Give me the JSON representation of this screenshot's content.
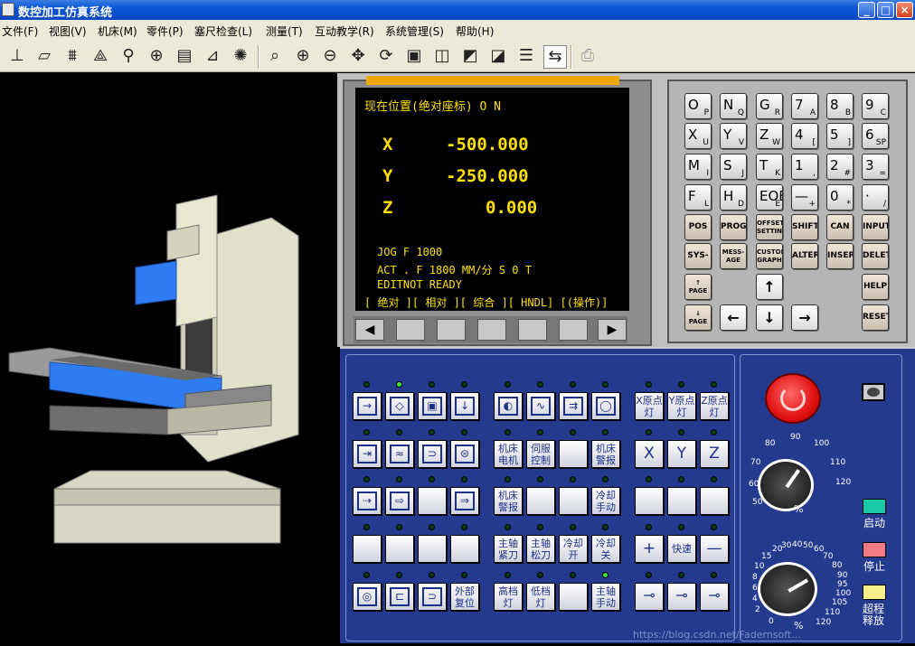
{
  "window": {
    "title": "数控加工仿真系统",
    "min": "_",
    "max": "□",
    "close": "×"
  },
  "menu": [
    "文件(F)",
    "视图(V)",
    "机床(M)",
    "零件(P)",
    "塞尺检查(L)",
    "测量(T)",
    "互动教学(R)",
    "系统管理(S)",
    "帮助(H)"
  ],
  "toolbar": {
    "icons": [
      "spindle-view-icon",
      "workpiece-icon",
      "clamp-icon",
      "tool-icon",
      "tool-change-icon",
      "origin-icon",
      "machine-icon",
      "measure-icon",
      "light-icon",
      "zoom-icon",
      "zoom-in-icon",
      "zoom-out-icon",
      "pan-icon",
      "rotate-icon",
      "front-view-icon",
      "iso-view-icon",
      "side-view-icon",
      "top-view-icon",
      "list-icon",
      "switch-icon",
      "print-icon"
    ]
  },
  "crt": {
    "header": "现在位置(绝对座标)  O     N",
    "x_label": "X",
    "x_value": "-500.000",
    "y_label": "Y",
    "y_value": "-250.000",
    "z_label": "Z",
    "z_value": "0.000",
    "line1": "JOG  F  1000",
    "line2": "ACT . F 1800  MM/分    S  0   T",
    "line3": "EDITNOT READY",
    "softkeys": "[ 绝对 ][ 相对 ][ 综合 ][ HNDL] [(操作)]"
  },
  "softkey_buttons": {
    "left": "◀",
    "right": "▶"
  },
  "keypad": {
    "rows": [
      [
        {
          "m": "O",
          "s": "P"
        },
        {
          "m": "N",
          "s": "Q"
        },
        {
          "m": "G",
          "s": "R"
        },
        {
          "m": "7",
          "s": "A"
        },
        {
          "m": "8",
          "s": "B"
        },
        {
          "m": "9",
          "s": "C"
        }
      ],
      [
        {
          "m": "X",
          "s": "U"
        },
        {
          "m": "Y",
          "s": "V"
        },
        {
          "m": "Z",
          "s": "W"
        },
        {
          "m": "4",
          "s": "["
        },
        {
          "m": "5",
          "s": "]"
        },
        {
          "m": "6",
          "s": "SP"
        }
      ],
      [
        {
          "m": "M",
          "s": "I"
        },
        {
          "m": "S",
          "s": "J"
        },
        {
          "m": "T",
          "s": "K"
        },
        {
          "m": "1",
          "s": ","
        },
        {
          "m": "2",
          "s": "#"
        },
        {
          "m": "3",
          "s": "="
        }
      ],
      [
        {
          "m": "F",
          "s": "L"
        },
        {
          "m": "H",
          "s": "D"
        },
        {
          "m": "EOB",
          "s": "E"
        },
        {
          "m": "—",
          "s": "+"
        },
        {
          "m": "0",
          "s": "*"
        },
        {
          "m": "·",
          "s": "/"
        }
      ]
    ],
    "fn_rows": [
      [
        "POS",
        "PROG",
        "OFFSET SETTING",
        "SHIFT",
        "CAN",
        "INPUT"
      ],
      [
        "SYS-TEM",
        "MESS-AGE",
        "CUSTOM GRAPH",
        "ALTER",
        "INSERT",
        "DELETE"
      ]
    ],
    "page_up": "↑ PAGE",
    "page_down": "↓ PAGE",
    "up": "↑",
    "left": "←",
    "down": "↓",
    "right": "→",
    "help": "HELP",
    "reset": "RESET"
  },
  "operator_panel": {
    "row2_labels": [
      "机床电机",
      "伺服控制",
      "",
      "机床警报"
    ],
    "row3_labels": [
      "机床警报",
      "",
      "",
      "冷却手动"
    ],
    "row4_labels": [
      "主轴紧刀",
      "主轴松刀",
      "冷却开",
      "冷却关"
    ],
    "row5_labels": [
      "高档灯",
      "低档灯",
      "",
      "主轴手动"
    ],
    "home_labels": [
      "X原点灯",
      "Y原点灯",
      "Z原点灯"
    ],
    "axis_labels": [
      "X",
      "Y",
      "Z"
    ],
    "rapid": [
      "+",
      "快速",
      "—"
    ],
    "external_reset": "外部复位",
    "feed_dial_ticks": [
      "50",
      "60",
      "70",
      "80",
      "90",
      "100",
      "110",
      "120"
    ],
    "spindle_dial_ticks": [
      "0",
      "2",
      "4",
      "6",
      "8",
      "10",
      "15",
      "20",
      "30",
      "40",
      "50",
      "60",
      "70",
      "80",
      "90",
      "95",
      "100",
      "105",
      "110",
      "120"
    ],
    "percent": "%",
    "start_label": "启动",
    "stop_label": "停止",
    "overtravel_label": "超程释放",
    "start_color": "#17c9a8",
    "stop_color": "#f27b86",
    "overtravel_color": "#f5ee8a"
  },
  "watermark": "https://blog.csdn.net/Fadernsoft..."
}
